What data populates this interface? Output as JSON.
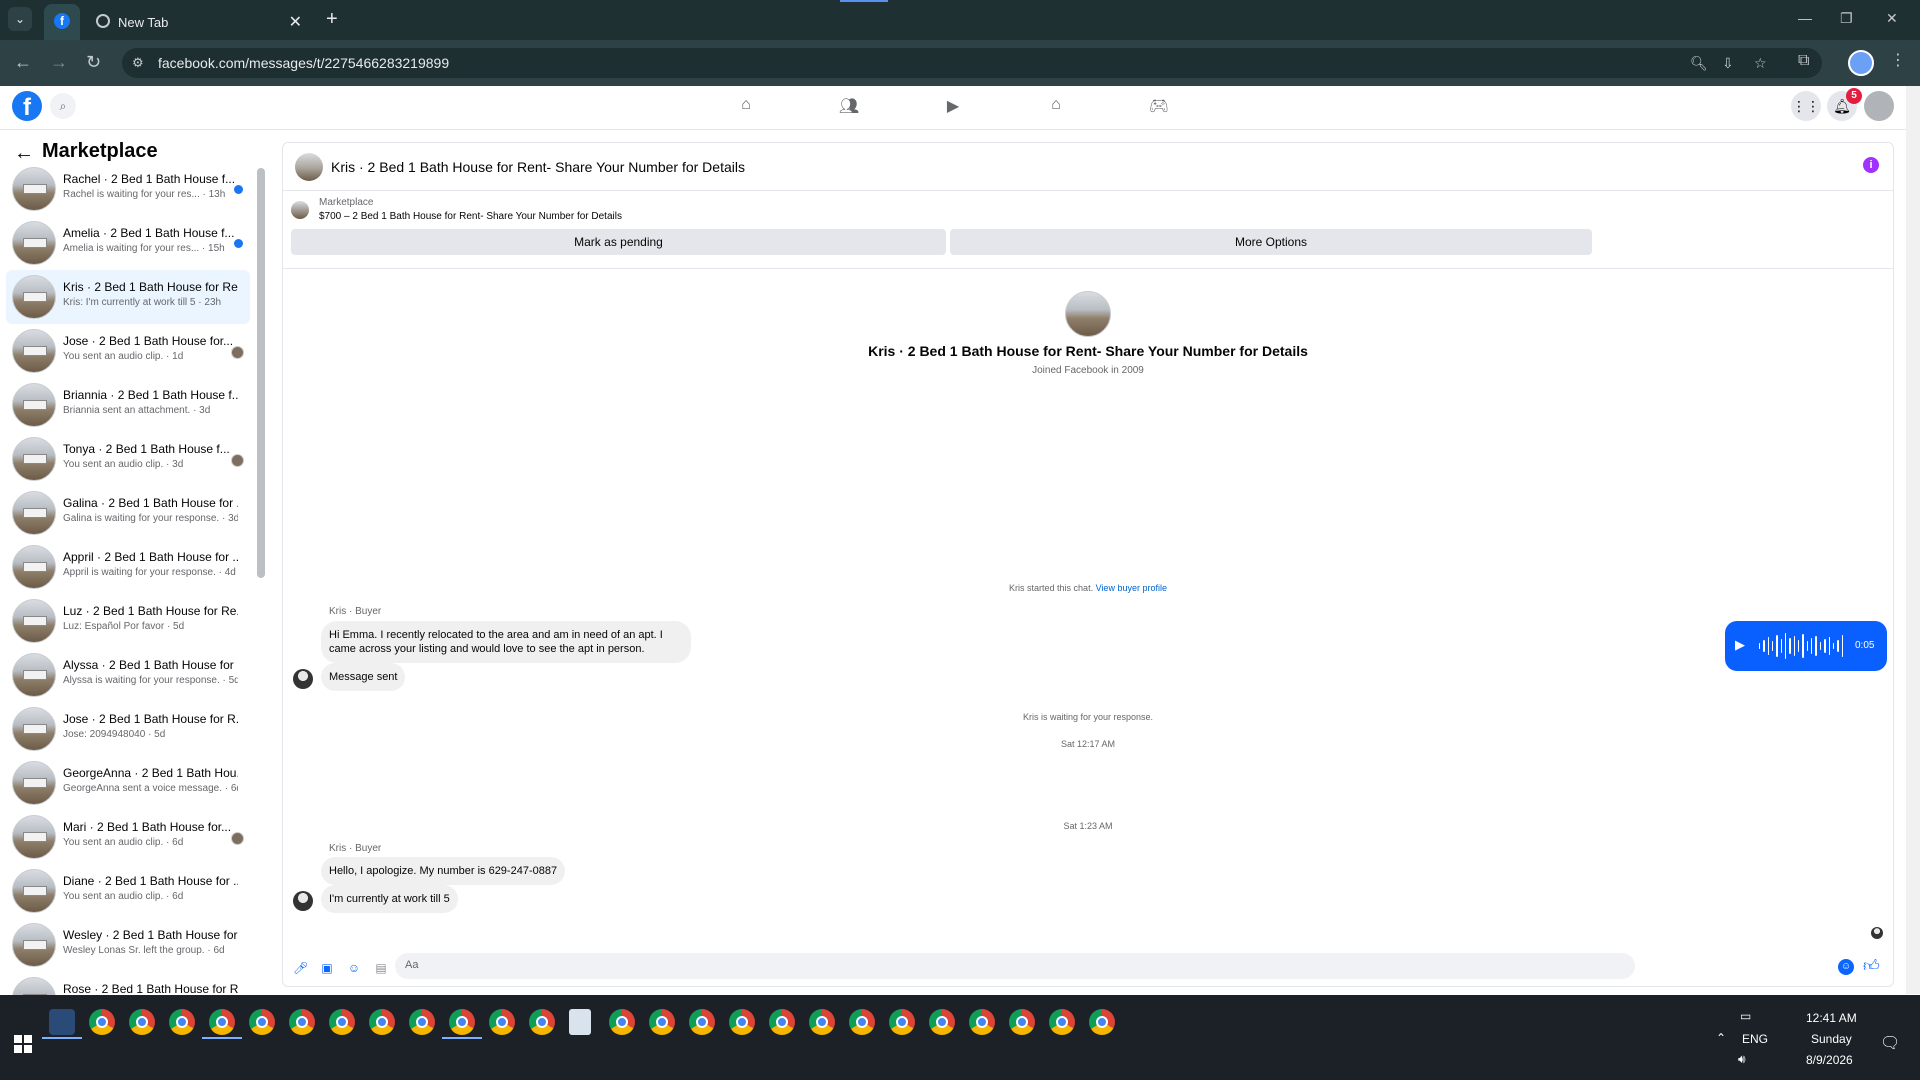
{
  "browser": {
    "tab_list_icon": "chevron-down-icon",
    "tabs": [
      {
        "title": "",
        "icon": "facebook-icon",
        "active": true
      },
      {
        "title": "New Tab",
        "icon": "chrome-icon",
        "active": false
      }
    ],
    "tab_close": "✕",
    "new_tab": "+",
    "url": "facebook.com/messages/t/2275466283219899",
    "window_controls": [
      "—",
      "❐",
      "✕"
    ]
  },
  "fb_header": {
    "notification_count": "5",
    "nav_icons": [
      "home-icon",
      "friends-icon",
      "watch-icon",
      "marketplace-icon",
      "gaming-icon"
    ]
  },
  "sidebar": {
    "title": "Marketplace",
    "conversations": [
      {
        "name": "Rachel · 2 Bed 1 Bath House f...",
        "preview": "Rachel is waiting for your res... · 13h",
        "unread": true
      },
      {
        "name": "Amelia · 2 Bed 1 Bath House f...",
        "preview": "Amelia is waiting for your res... · 15h",
        "unread": true
      },
      {
        "name": "Kris · 2 Bed 1 Bath House for Re...",
        "preview": "Kris: I'm currently at work till 5 · 23h",
        "active": true
      },
      {
        "name": "Jose · 2 Bed 1 Bath House for...",
        "preview": "You sent an audio clip. · 1d",
        "seen": true
      },
      {
        "name": "Briannia · 2 Bed 1 Bath House f...",
        "preview": "Briannia sent an attachment. · 3d"
      },
      {
        "name": "Tonya · 2 Bed 1 Bath House f...",
        "preview": "You sent an audio clip. · 3d",
        "seen": true
      },
      {
        "name": "Galina · 2 Bed 1 Bath House for ...",
        "preview": "Galina is waiting for your response. · 3d"
      },
      {
        "name": "Appril · 2 Bed 1 Bath House for ...",
        "preview": "Appril is waiting for your response. · 4d"
      },
      {
        "name": "Luz · 2 Bed 1 Bath House for Re...",
        "preview": "Luz: Español Por favor · 5d"
      },
      {
        "name": "Alyssa · 2 Bed 1 Bath House for ...",
        "preview": "Alyssa is waiting for your response. · 5d"
      },
      {
        "name": "Jose · 2 Bed 1 Bath House for R...",
        "preview": "Jose: 2094948040 · 5d"
      },
      {
        "name": "GeorgeAnna · 2 Bed 1 Bath Hou...",
        "preview": "GeorgeAnna sent a voice message. · 6d"
      },
      {
        "name": "Mari · 2 Bed 1 Bath House for...",
        "preview": "You sent an audio clip. · 6d",
        "seen": true
      },
      {
        "name": "Diane · 2 Bed 1 Bath House for ...",
        "preview": "You sent an audio clip. · 6d"
      },
      {
        "name": "Wesley · 2 Bed 1 Bath House for...",
        "preview": "Wesley Lonas Sr. left the group. · 6d"
      },
      {
        "name": "Rose · 2 Bed 1 Bath House for R...",
        "preview": ""
      }
    ]
  },
  "thread": {
    "title": "Kris · 2 Bed 1 Bath House for Rent- Share Your Number for Details",
    "listing_label": "Marketplace",
    "listing_price": "$700 – 2 Bed 1 Bath House for Rent- Share Your Number for Details",
    "mark_pending": "Mark as pending",
    "more_options": "More Options",
    "profile_name": "Kris · 2 Bed 1 Bath House for Rent- Share Your Number for Details",
    "joined": "Joined Facebook in 2009",
    "started_text": "Kris started this chat.",
    "view_profile": "View buyer profile",
    "sender_label_1": "Kris · Buyer",
    "msg_1": "Hi Emma. I recently relocated to the area and am in need of an apt. I came across your listing and would love to see the apt in person.",
    "msg_2": "Message sent",
    "waiting": "Kris is waiting for your response.",
    "time_1": "Sat 12:17 AM",
    "audio_duration": "0:05",
    "time_2": "Sat 1:23 AM",
    "sender_label_2": "Kris · Buyer",
    "msg_3": "Hello, I apologize. My number is 629-247-0887",
    "msg_4": "I'm currently at work till 5",
    "composer_placeholder": "Aa"
  },
  "taskbar": {
    "time": "12:41 AM",
    "day": "Sunday",
    "date": "8/9/2026",
    "lang": "ENG"
  }
}
